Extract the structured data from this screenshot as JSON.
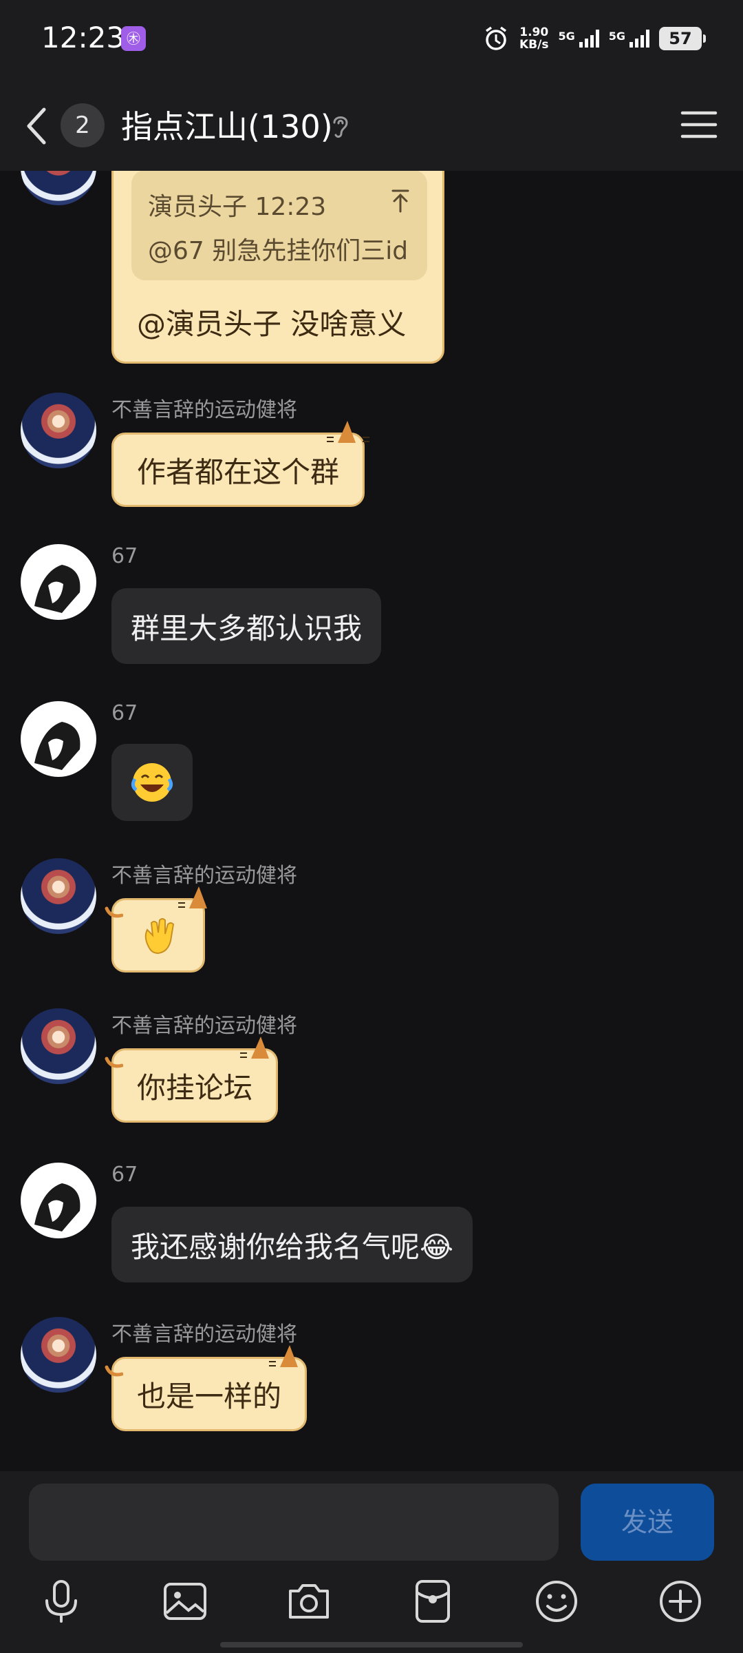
{
  "status": {
    "time": "12:23",
    "app_icon_glyph": "㊍",
    "speed_value": "1.90",
    "speed_unit": "KB/s",
    "net1": "5G",
    "net2": "5G",
    "battery": "57"
  },
  "header": {
    "unread_count": "2",
    "title": "指点江山(130)",
    "icons": {
      "back": "back-chevron-icon",
      "ear": "earpiece-icon",
      "menu": "hamburger-menu-icon"
    }
  },
  "messages": [
    {
      "quote": {
        "meta": "演员头子 12:23",
        "text": "@67 别急先挂你们三id"
      },
      "text": "@演员头子 没啥意义"
    },
    {
      "sender": "不善言辞的运动健将",
      "text": "作者都在这个群"
    },
    {
      "sender": "67",
      "text": "群里大多都认识我"
    },
    {
      "sender": "67",
      "emoji": "laughing-crying-emoji"
    },
    {
      "sender": "不善言辞的运动健将",
      "emoji": "waving-hand-emoji"
    },
    {
      "sender": "不善言辞的运动健将",
      "text": "你挂论坛"
    },
    {
      "sender": "67",
      "text": "我还感谢你给我名气呢😂"
    },
    {
      "sender": "不善言辞的运动健将",
      "text": "也是一样的"
    }
  ],
  "composer": {
    "placeholder": "",
    "send_label": "发送",
    "toolbar": [
      "microphone-icon",
      "image-icon",
      "camera-icon",
      "red-packet-icon",
      "emoji-icon",
      "plus-icon"
    ]
  },
  "colors": {
    "background": "#121214",
    "bar": "#1c1c1e",
    "dark_bubble": "#2a2a2d",
    "cat_bubble": "#fbe6b6",
    "send_button": "#0e4d99"
  }
}
